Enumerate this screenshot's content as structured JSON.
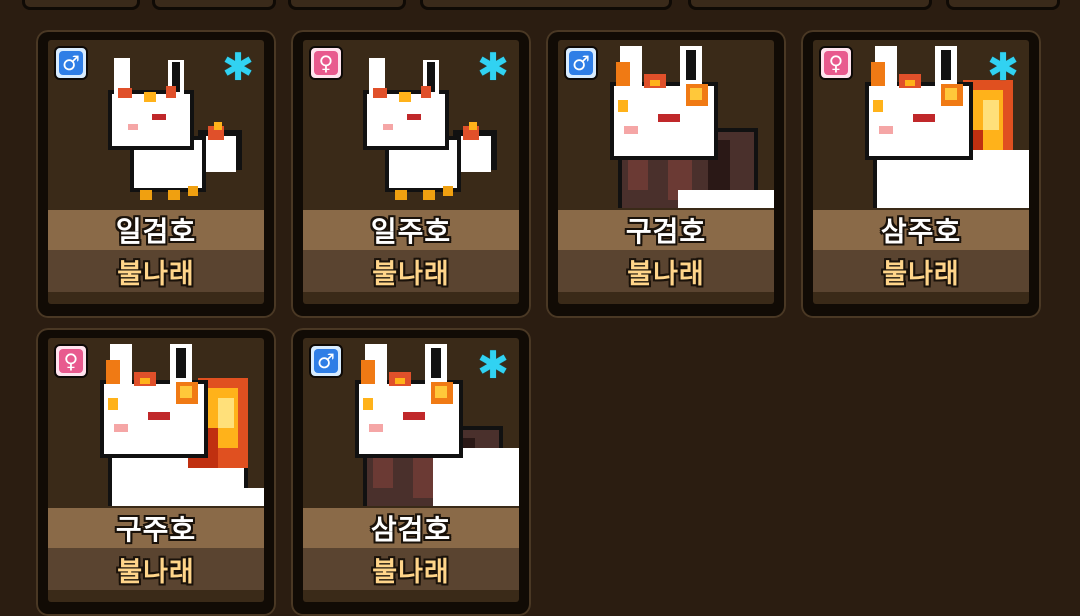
{
  "cards": [
    {
      "name": "일검호",
      "attribute": "불나래",
      "gender": "male",
      "gender_symbol": "♂",
      "element_icon": "snowflake-icon",
      "element_symbol": "✱",
      "variant": "small"
    },
    {
      "name": "일주호",
      "attribute": "불나래",
      "gender": "female",
      "gender_symbol": "♀",
      "element_icon": "snowflake-icon",
      "element_symbol": "✱",
      "variant": "small"
    },
    {
      "name": "구검호",
      "attribute": "불나래",
      "gender": "male",
      "gender_symbol": "♂",
      "element_icon": "",
      "element_symbol": "",
      "variant": "large-dark"
    },
    {
      "name": "삼주호",
      "attribute": "불나래",
      "gender": "female",
      "gender_symbol": "♀",
      "element_icon": "snowflake-icon",
      "element_symbol": "✱",
      "variant": "medium-fire"
    },
    {
      "name": "구주호",
      "attribute": "불나래",
      "gender": "female",
      "gender_symbol": "♀",
      "element_icon": "",
      "element_symbol": "",
      "variant": "large-fire"
    },
    {
      "name": "삼검호",
      "attribute": "불나래",
      "gender": "male",
      "gender_symbol": "♂",
      "element_icon": "snowflake-icon",
      "element_symbol": "✱",
      "variant": "medium-dark"
    }
  ],
  "colors": {
    "background": "#2b1d11",
    "male": "#2f7ee6",
    "female": "#e85a8e",
    "element": "#31d2f2",
    "name_bar": "#8a6a48",
    "attr_bar": "#5a4430",
    "attr_text": "#ffd58a"
  }
}
